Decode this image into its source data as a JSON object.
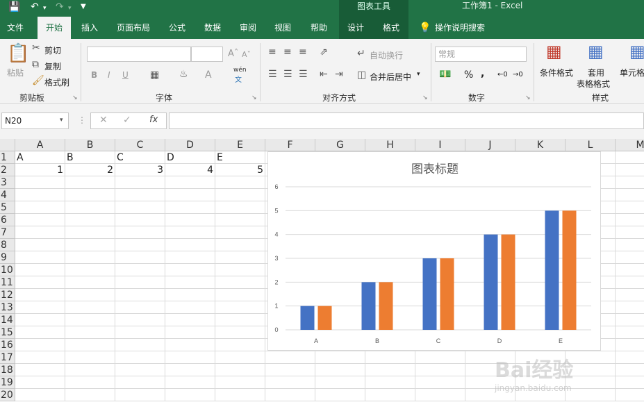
{
  "titlebar": {
    "context_header": "图表工具",
    "doc_title": "工作簿1  -  Excel"
  },
  "tabs": [
    "文件",
    "开始",
    "插入",
    "页面布局",
    "公式",
    "数据",
    "审阅",
    "视图",
    "帮助",
    "设计",
    "格式"
  ],
  "active_tab": "开始",
  "tell_me": "操作说明搜索",
  "ribbon": {
    "clipboard": {
      "paste": "粘贴",
      "cut": "剪切",
      "copy": "复制",
      "format_painter": "格式刷",
      "label": "剪贴板"
    },
    "font": {
      "label": "字体",
      "bold": "B",
      "italic": "I",
      "underline": "U",
      "wen": "wén",
      "wen_char": "文"
    },
    "alignment": {
      "label": "对齐方式",
      "wrap": "自动换行",
      "merge": "合并后居中"
    },
    "number": {
      "label": "数字",
      "format": "常规",
      "percent": "%",
      "comma": ","
    },
    "styles": {
      "label": "样式",
      "conditional": "条件格式",
      "table_format_line1": "套用",
      "table_format_line2": "表格格式",
      "cell_styles": "单元格"
    }
  },
  "formula_bar": {
    "name_box": "N20",
    "value": ""
  },
  "columns": [
    "A",
    "B",
    "C",
    "D",
    "E",
    "F",
    "G",
    "H",
    "I",
    "J",
    "K",
    "L",
    "M"
  ],
  "rows": [
    "1",
    "2",
    "3",
    "4",
    "5",
    "6",
    "7",
    "8",
    "9",
    "10",
    "11",
    "12",
    "13",
    "14",
    "15",
    "16",
    "17",
    "18",
    "19",
    "20"
  ],
  "cells": {
    "A1": "A",
    "B1": "B",
    "C1": "C",
    "D1": "D",
    "E1": "E",
    "A2": "1",
    "B2": "2",
    "C2": "3",
    "D2": "4",
    "E2": "5"
  },
  "chart_data": {
    "type": "bar",
    "title": "图表标题",
    "categories": [
      "A",
      "B",
      "C",
      "D",
      "E"
    ],
    "series": [
      {
        "values": [
          1,
          2,
          3,
          4,
          5
        ],
        "color": "#4472c4"
      },
      {
        "values": [
          1,
          2,
          3,
          4,
          5
        ],
        "color": "#ed7d31"
      }
    ],
    "ylim": [
      0,
      6
    ],
    "yticks": [
      0,
      1,
      2,
      3,
      4,
      5,
      6
    ],
    "grid": true
  },
  "watermark": {
    "main": "Bai经验",
    "sub": "jingyan.baidu.com"
  }
}
